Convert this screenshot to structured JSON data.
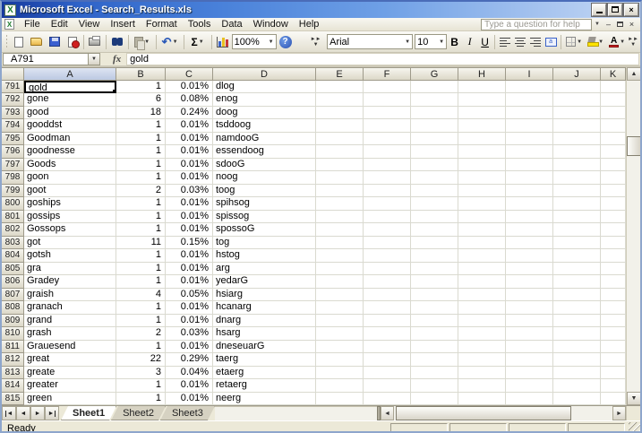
{
  "window": {
    "title": "Microsoft Excel - Search_Results.xls"
  },
  "menu": {
    "items": [
      "File",
      "Edit",
      "View",
      "Insert",
      "Format",
      "Tools",
      "Data",
      "Window",
      "Help"
    ],
    "help_placeholder": "Type a question for help"
  },
  "toolbar": {
    "zoom_value": "100%",
    "font_name": "Arial",
    "font_size": "10",
    "bold_label": "B",
    "italic_label": "I",
    "underline_label": "U",
    "autosum_label": "Σ",
    "merge_label": "a"
  },
  "formula_bar": {
    "name_box": "A791",
    "fx_label": "fx",
    "value": "gold"
  },
  "icons": {
    "dropdown": "▼",
    "up": "▲",
    "down": "▼",
    "left": "◄",
    "right": "►",
    "undo": "↶",
    "help_mark": "?",
    "close": "×",
    "excel_x": "X"
  },
  "grid": {
    "columns": [
      "A",
      "B",
      "C",
      "D",
      "E",
      "F",
      "G",
      "H",
      "I",
      "J",
      "K"
    ],
    "selected_column": "A",
    "selection": "A791",
    "rows": [
      {
        "n": 791,
        "v": [
          "gold",
          "1",
          "0.01%",
          "dlog"
        ]
      },
      {
        "n": 792,
        "v": [
          "gone",
          "6",
          "0.08%",
          "enog"
        ]
      },
      {
        "n": 793,
        "v": [
          "good",
          "18",
          "0.24%",
          "doog"
        ]
      },
      {
        "n": 794,
        "v": [
          "gooddst",
          "1",
          "0.01%",
          "tsddoog"
        ]
      },
      {
        "n": 795,
        "v": [
          "Goodman",
          "1",
          "0.01%",
          "namdooG"
        ]
      },
      {
        "n": 796,
        "v": [
          "goodnesse",
          "1",
          "0.01%",
          "essendoog"
        ]
      },
      {
        "n": 797,
        "v": [
          "Goods",
          "1",
          "0.01%",
          "sdooG"
        ]
      },
      {
        "n": 798,
        "v": [
          "goon",
          "1",
          "0.01%",
          "noog"
        ]
      },
      {
        "n": 799,
        "v": [
          "goot",
          "2",
          "0.03%",
          "toog"
        ]
      },
      {
        "n": 800,
        "v": [
          "goships",
          "1",
          "0.01%",
          "spihsog"
        ]
      },
      {
        "n": 801,
        "v": [
          "gossips",
          "1",
          "0.01%",
          "spissog"
        ]
      },
      {
        "n": 802,
        "v": [
          "Gossops",
          "1",
          "0.01%",
          "spossoG"
        ]
      },
      {
        "n": 803,
        "v": [
          "got",
          "11",
          "0.15%",
          "tog"
        ]
      },
      {
        "n": 804,
        "v": [
          "gotsh",
          "1",
          "0.01%",
          "hstog"
        ]
      },
      {
        "n": 805,
        "v": [
          "gra",
          "1",
          "0.01%",
          "arg"
        ]
      },
      {
        "n": 806,
        "v": [
          "Gradey",
          "1",
          "0.01%",
          "yedarG"
        ]
      },
      {
        "n": 807,
        "v": [
          "graish",
          "4",
          "0.05%",
          "hsiarg"
        ]
      },
      {
        "n": 808,
        "v": [
          "granach",
          "1",
          "0.01%",
          "hcanarg"
        ]
      },
      {
        "n": 809,
        "v": [
          "grand",
          "1",
          "0.01%",
          "dnarg"
        ]
      },
      {
        "n": 810,
        "v": [
          "grash",
          "2",
          "0.03%",
          "hsarg"
        ]
      },
      {
        "n": 811,
        "v": [
          "Grauesend",
          "1",
          "0.01%",
          "dneseuarG"
        ]
      },
      {
        "n": 812,
        "v": [
          "great",
          "22",
          "0.29%",
          "taerg"
        ]
      },
      {
        "n": 813,
        "v": [
          "greate",
          "3",
          "0.04%",
          "etaerg"
        ]
      },
      {
        "n": 814,
        "v": [
          "greater",
          "1",
          "0.01%",
          "retaerg"
        ]
      },
      {
        "n": 815,
        "v": [
          "green",
          "1",
          "0.01%",
          "neerg"
        ]
      }
    ]
  },
  "sheet_tabs": {
    "tabs": [
      "Sheet1",
      "Sheet2",
      "Sheet3"
    ],
    "active": "Sheet1"
  },
  "status_bar": {
    "ready": "Ready"
  }
}
